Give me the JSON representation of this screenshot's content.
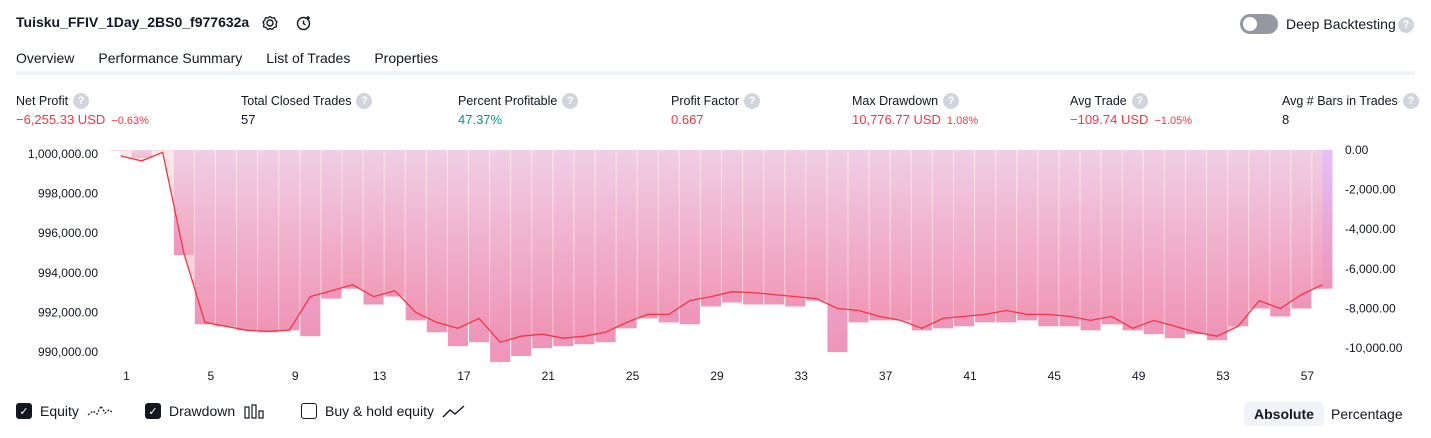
{
  "header": {
    "title": "Tuisku_FFIV_1Day_2BS0_f977632a",
    "deep_backtesting_label": "Deep Backtesting",
    "help_glyph": "?"
  },
  "tabs": [
    {
      "label": "Overview",
      "active": true
    },
    {
      "label": "Performance Summary",
      "active": false
    },
    {
      "label": "List of Trades",
      "active": false
    },
    {
      "label": "Properties",
      "active": false
    }
  ],
  "stats": [
    {
      "label": "Net Profit",
      "value": "−6,255.33 USD",
      "pct": "−0.63%",
      "tone": "neg"
    },
    {
      "label": "Total Closed Trades",
      "value": "57",
      "pct": "",
      "tone": "plain"
    },
    {
      "label": "Percent Profitable",
      "value": "47.37%",
      "pct": "",
      "tone": "pos"
    },
    {
      "label": "Profit Factor",
      "value": "0.667",
      "pct": "",
      "tone": "neg"
    },
    {
      "label": "Max Drawdown",
      "value": "10,776.77 USD",
      "pct": "1.08%",
      "tone": "neg"
    },
    {
      "label": "Avg Trade",
      "value": "−109.74 USD",
      "pct": "−1.05%",
      "tone": "neg"
    },
    {
      "label": "Avg # Bars in Trades",
      "value": "8",
      "pct": "",
      "tone": "plain"
    }
  ],
  "legend": {
    "equity_label": "Equity",
    "drawdown_label": "Drawdown",
    "buy_hold_label": "Buy & hold equity",
    "equity_checked": true,
    "drawdown_checked": true,
    "buy_hold_checked": false
  },
  "modes": {
    "absolute": "Absolute",
    "percentage": "Percentage",
    "selected": "absolute"
  },
  "colors": {
    "negative": "#f23645",
    "positive": "#089981",
    "equity_line": "#f23645",
    "drawdown_top": "#e1bdfa",
    "drawdown_bottom": "#ee8fb4",
    "equity_area_top": "#fbd9d5",
    "equity_area_bottom": "#ef8fae"
  },
  "icons": [
    "settings-icon",
    "rocket-icon",
    "help-icon",
    "checkmark-icon",
    "equity-icon",
    "drawdown-bars-icon",
    "buy-hold-line-icon"
  ],
  "chart_data": {
    "type": "area",
    "left_axis": {
      "ticks": [
        1000000,
        998000,
        996000,
        994000,
        992000,
        990000
      ],
      "tick_labels": [
        "1,000,000.00",
        "998,000.00",
        "996,000.00",
        "994,000.00",
        "992,000.00",
        "990,000.00"
      ],
      "ylim": [
        989600,
        1000200
      ]
    },
    "right_axis": {
      "ticks": [
        0,
        -2000,
        -4000,
        -6000,
        -8000,
        -10000
      ],
      "tick_labels": [
        "0.00",
        "-2,000.00",
        "-4,000.00",
        "-6,000.00",
        "-8,000.00",
        "-10,000.00"
      ],
      "ylim": [
        -10600,
        0
      ]
    },
    "x_tick_labels": [
      "1",
      "5",
      "9",
      "13",
      "17",
      "21",
      "25",
      "29",
      "33",
      "37",
      "41",
      "45",
      "49",
      "53",
      "57"
    ],
    "x_ticks": [
      1,
      5,
      9,
      13,
      17,
      21,
      25,
      29,
      33,
      37,
      41,
      45,
      49,
      53,
      57
    ],
    "trades": [
      1,
      2,
      3,
      4,
      5,
      6,
      7,
      8,
      9,
      10,
      11,
      12,
      13,
      14,
      15,
      16,
      17,
      18,
      19,
      20,
      21,
      22,
      23,
      24,
      25,
      26,
      27,
      28,
      29,
      30,
      31,
      32,
      33,
      34,
      35,
      36,
      37,
      38,
      39,
      40,
      41,
      42,
      43,
      44,
      45,
      46,
      47,
      48,
      49,
      50,
      51,
      52,
      53,
      54,
      55,
      56,
      57,
      58
    ],
    "series": [
      {
        "name": "Equity",
        "values": [
          999900,
          999650,
          1000080,
          995000,
          991500,
          991300,
          991100,
          991050,
          991100,
          992800,
          993100,
          993400,
          992800,
          993100,
          992000,
          991500,
          991200,
          991700,
          990500,
          990800,
          990900,
          990700,
          990800,
          991000,
          991500,
          991900,
          991900,
          992600,
          992800,
          993050,
          993000,
          992900,
          992800,
          992700,
          992200,
          992100,
          991800,
          991600,
          991200,
          991700,
          991800,
          991900,
          992100,
          991900,
          991900,
          991800,
          991600,
          991800,
          991200,
          991600,
          991300,
          991000,
          990800,
          991300,
          992600,
          992200,
          992900,
          993400
        ]
      },
      {
        "name": "Drawdown",
        "values": [
          0,
          -400,
          0,
          -5300,
          -8800,
          -8900,
          -9100,
          -9200,
          -9100,
          -9400,
          -7500,
          -7000,
          -7800,
          -7400,
          -8600,
          -9200,
          -9900,
          -9700,
          -10700,
          -10400,
          -10000,
          -9900,
          -9800,
          -9700,
          -9000,
          -8500,
          -8700,
          -8800,
          -7900,
          -7700,
          -7800,
          -7800,
          -7900,
          -7600,
          -10200,
          -8700,
          -8600,
          -8600,
          -9100,
          -9000,
          -8900,
          -8700,
          -8700,
          -8600,
          -8900,
          -8900,
          -9100,
          -8800,
          -9100,
          -9300,
          -9500,
          -9300,
          -9600,
          -8900,
          -8000,
          -8400,
          -8000,
          -7000
        ]
      }
    ]
  }
}
